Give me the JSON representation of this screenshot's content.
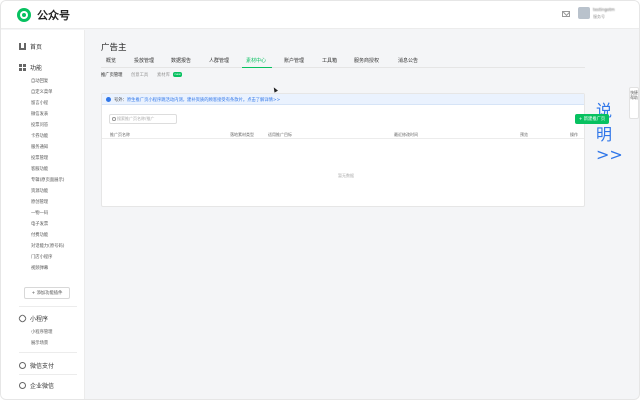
{
  "app": {
    "title": "公众号"
  },
  "account": {
    "name": "testingotm",
    "subtitle": "服务号"
  },
  "sidebar": {
    "home": "首页",
    "features": "功能",
    "feature_items": [
      "自动回复",
      "自定义菜单",
      "留言小程",
      "微信发表",
      "投票问答",
      "卡券功能",
      "服务通知",
      "投票管理",
      "客服功能",
      "专辑(原页面展示)",
      "资源功能",
      "原创管理",
      "一物一码",
      "电子发票",
      "付费功能",
      "对话能力(原号码)",
      "门店小程序",
      "视频弹幕"
    ],
    "add_plugin": "+ 添加功能插件",
    "miniprogram": "小程序",
    "mini_items": [
      "小程序管理",
      "展示场景"
    ],
    "wechat_pay": "微信支付",
    "work_wechat": "企业微信"
  },
  "main": {
    "title": "广告主",
    "tabs": [
      "概览",
      "投放管理",
      "数据报告",
      "人群管理",
      "素材中心",
      "账户管理",
      "工具箱",
      "服务商授权",
      "消息公告"
    ],
    "active_tab_index": 4,
    "subtabs": [
      "推广页管理",
      "创意工具",
      "素材库"
    ],
    "subtab_badge": "new",
    "notice": {
      "prefix": "号外：",
      "text": "原生推广页小程序跳活动内测，建补资质的顾客接受有条款片。点击了解详情>>",
      "right_link": "说明>>"
    },
    "search_placeholder": "搜索推广页名称/推广",
    "create_button": "+ 新建推广页",
    "columns": [
      "推广页名称",
      "落地素材类型",
      "适用推广目标",
      "最近修改时间",
      "预览",
      "操作"
    ],
    "empty_text": "暂无数据"
  },
  "float_panel": {
    "label": "快捷帮助"
  },
  "colors": {
    "accent": "#07c160",
    "link": "#2f76e9",
    "notice_bg": "#eaf2fe"
  }
}
